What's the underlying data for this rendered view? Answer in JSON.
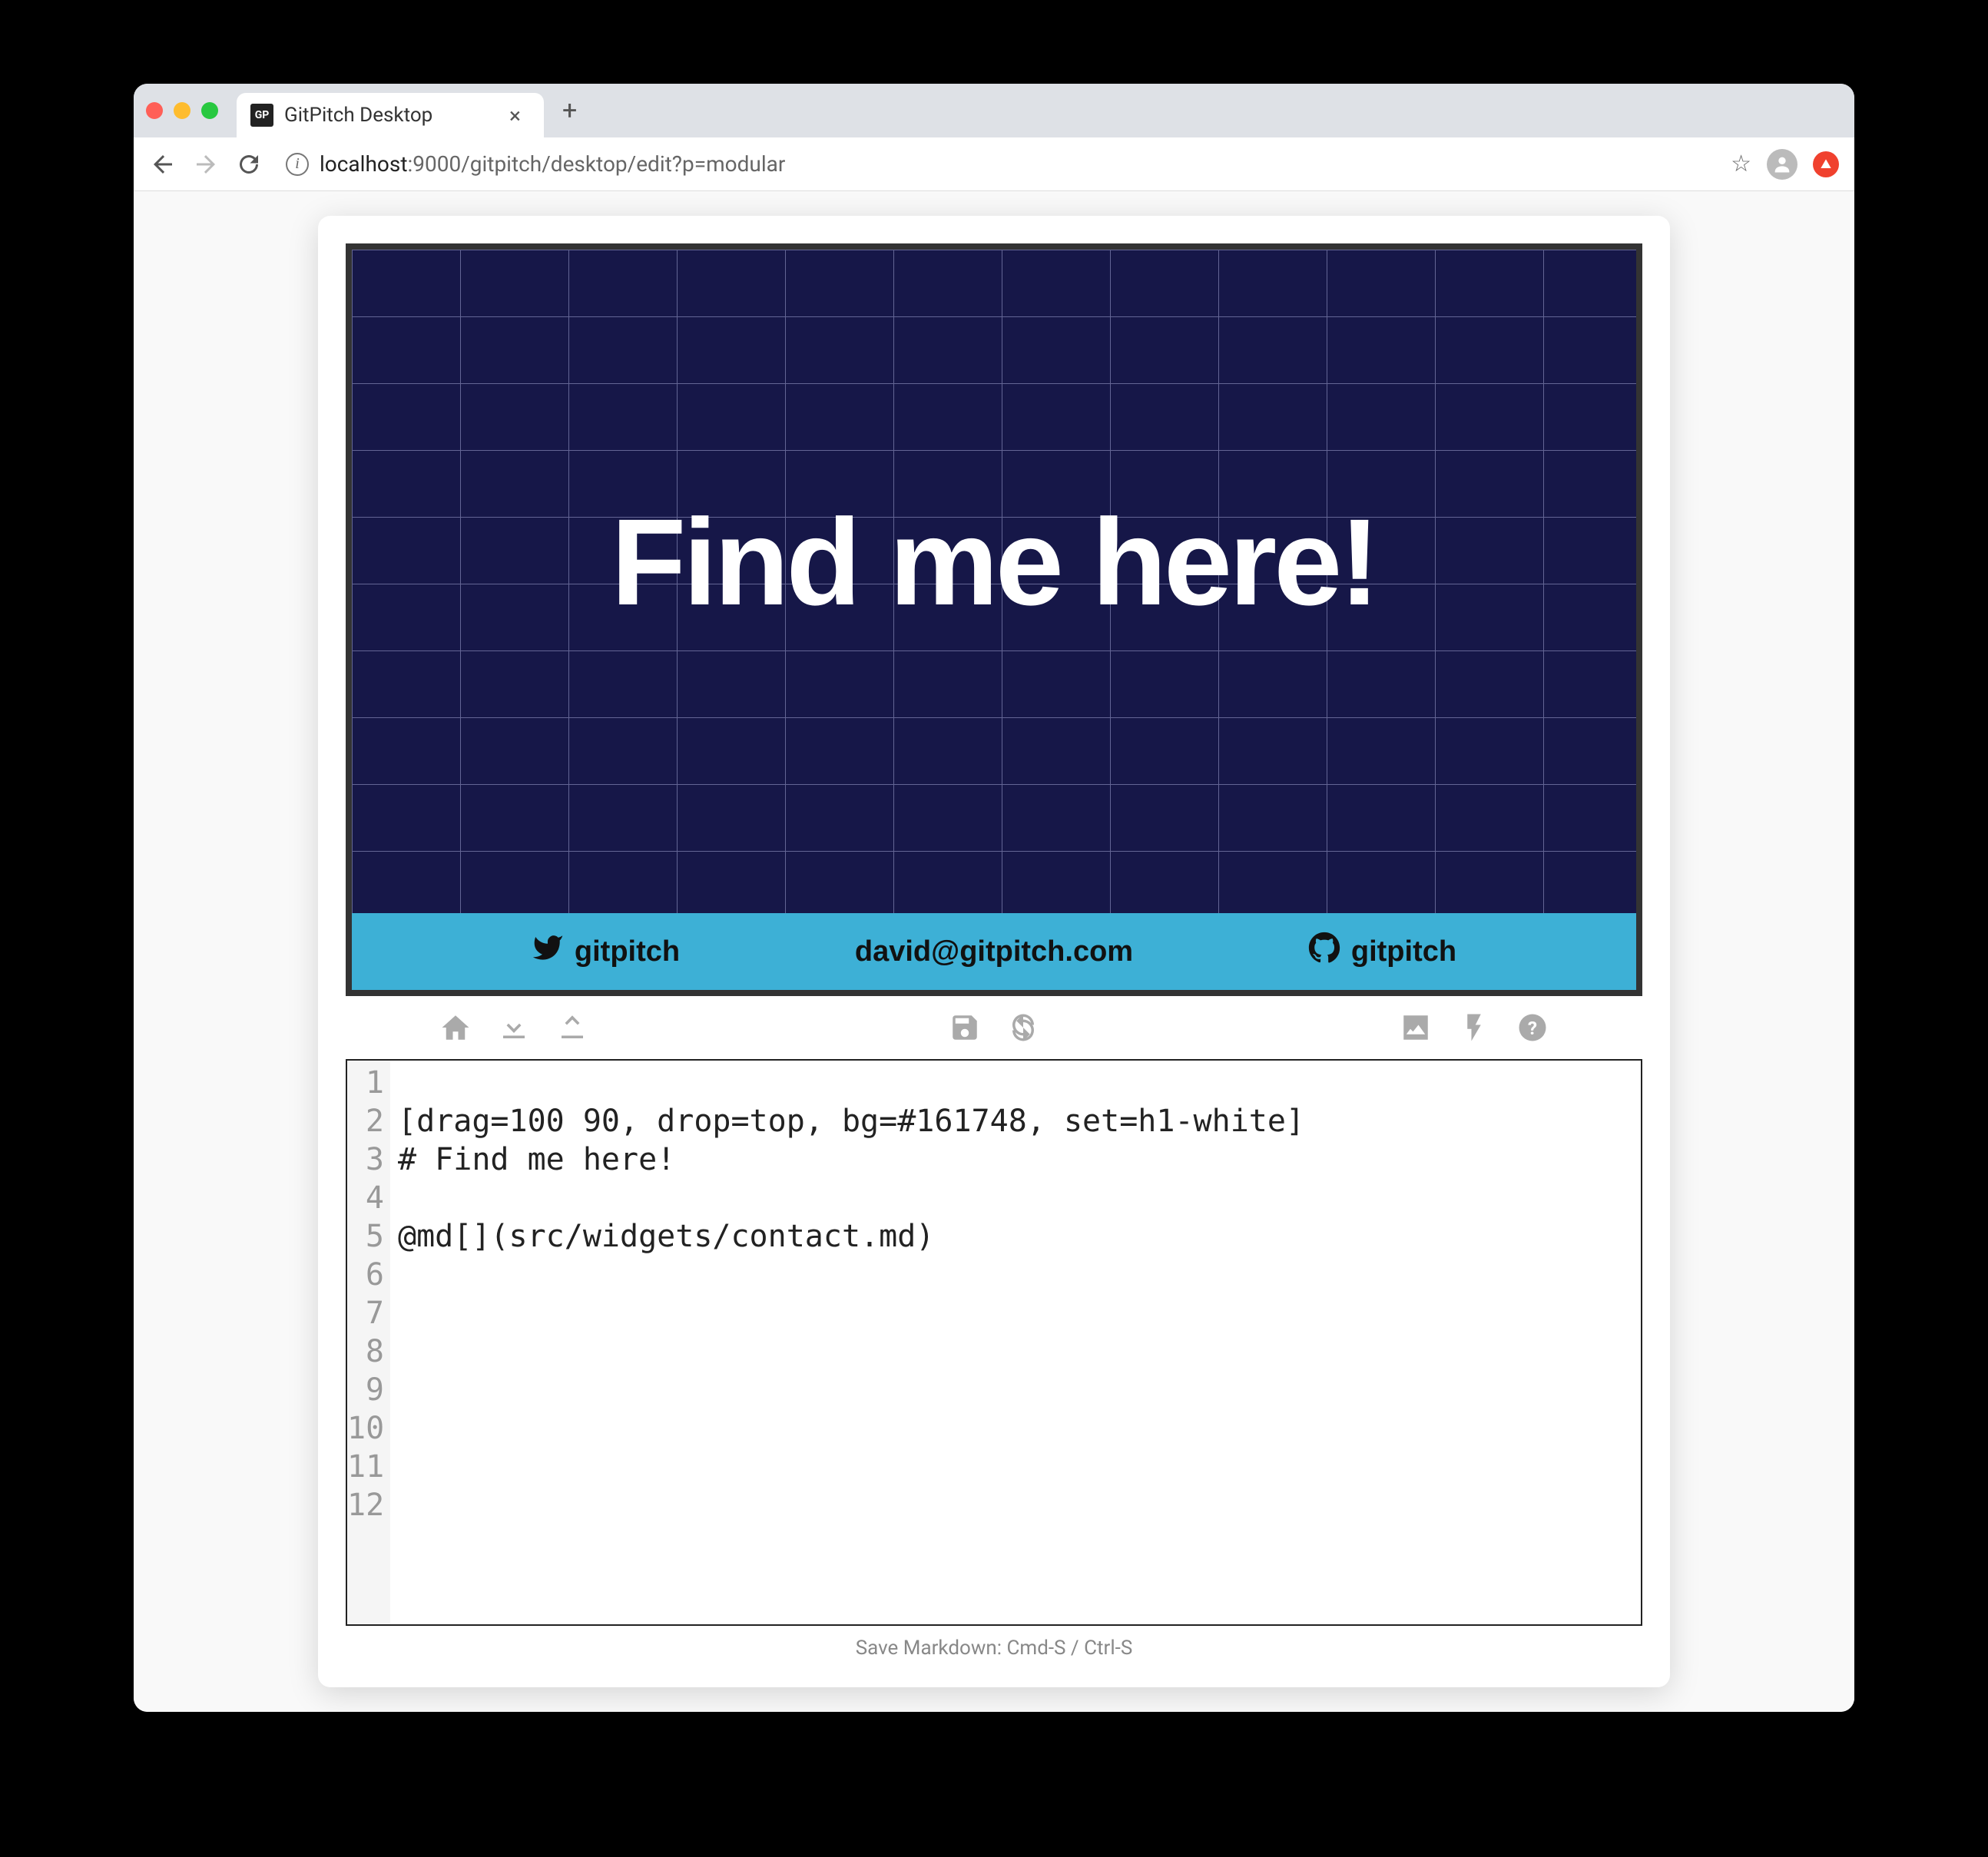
{
  "browser": {
    "tab_title": "GitPitch Desktop",
    "favicon_text": "GP",
    "url_host": "localhost",
    "url_path": ":9000/gitpitch/desktop/edit?p=modular"
  },
  "slide": {
    "heading": "Find me here!",
    "footer": {
      "twitter_label": "gitpitch",
      "email": "david@gitpitch.com",
      "github_label": "gitpitch"
    }
  },
  "editor": {
    "line_numbers": [
      "1",
      "2",
      "3",
      "4",
      "5",
      "6",
      "7",
      "8",
      "9",
      "10",
      "11",
      "12"
    ],
    "lines": [
      "",
      "[drag=100 90, drop=top, bg=#161748, set=h1-white]",
      "# Find me here!",
      "",
      "@md[](src/widgets/contact.md)",
      "",
      "",
      "",
      "",
      "",
      "",
      ""
    ]
  },
  "status_bar": "Save Markdown: Cmd-S / Ctrl-S"
}
